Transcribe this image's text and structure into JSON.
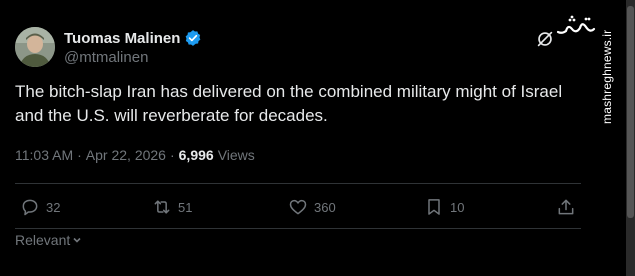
{
  "author": {
    "name": "Tuomas Malinen",
    "handle": "@mtmalinen",
    "verified": true,
    "verified_color": "#1d9bf0"
  },
  "tweet": {
    "text": "The bitch-slap Iran has delivered on the combined military might of Israel and the U.S. will reverberate for decades.",
    "time": "11:03 AM",
    "separator": "·",
    "date": "Apr 22, 2026",
    "views_count": "6,996",
    "views_label": "Views"
  },
  "actions": {
    "replies": "32",
    "reposts": "51",
    "likes": "360",
    "bookmarks": "10"
  },
  "sort": {
    "label": "Relevant"
  },
  "watermark": {
    "site": "mashreghnews.ir",
    "logo_text": "مشرق"
  },
  "colors": {
    "background": "#000000",
    "text": "#e7e9ea",
    "muted": "#71767b",
    "divider": "#2f3336"
  },
  "icons": [
    "grok-icon",
    "verified-badge-icon",
    "reply-icon",
    "repost-icon",
    "like-icon",
    "bookmark-icon",
    "share-icon",
    "chevron-down-icon"
  ]
}
